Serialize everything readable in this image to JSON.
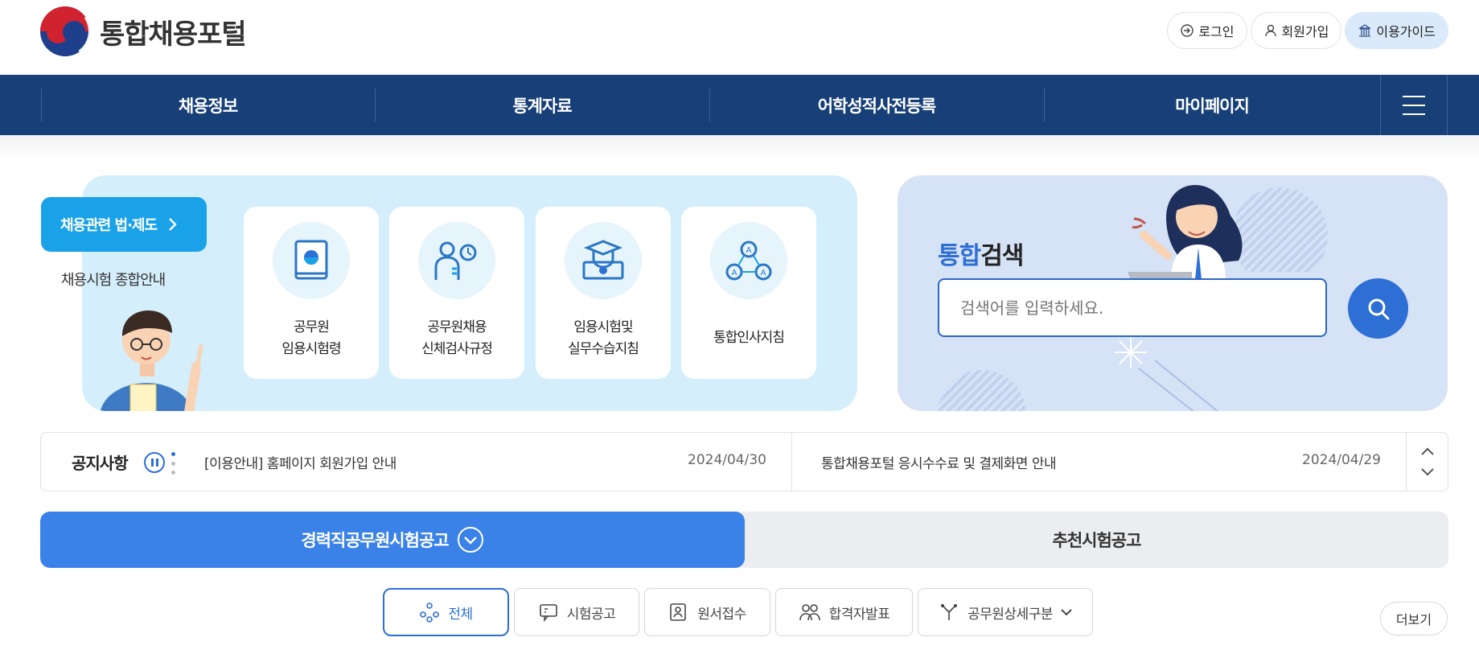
{
  "header": {
    "logo_text": "통합채용포털",
    "top_links": [
      "로그인",
      "회원가입",
      "이용가이드"
    ]
  },
  "nav": {
    "items": [
      "채용정보",
      "통계자료",
      "어학성적사전등록",
      "마이페이지"
    ]
  },
  "law": {
    "button_label": "채용관련 법·제도",
    "subtitle": "채용시험 종합안내",
    "cards": [
      {
        "line1": "공무원",
        "line2": "임용시험령",
        "icon": "book-icon"
      },
      {
        "line1": "공무원채용",
        "line2": "신체검사규정",
        "icon": "physical-exam-icon"
      },
      {
        "line1": "임용시험및",
        "line2": "실무수습지침",
        "icon": "graduate-icon"
      },
      {
        "line1": "통합인사지침",
        "line2": "",
        "icon": "network-icon"
      }
    ]
  },
  "search": {
    "title_highlight": "통합",
    "title_rest": "검색",
    "placeholder": "검색어를 입력하세요."
  },
  "notice": {
    "title": "공지사항",
    "items": [
      {
        "text": "[이용안내] 홈페이지 회원가입 안내",
        "date": "2024/04/30"
      },
      {
        "text": "통합채용포털 응시수수료 및 결제화면 안내",
        "date": "2024/04/29"
      }
    ]
  },
  "tabs": {
    "active": "경력직공무원시험공고",
    "other": "추천시험공고"
  },
  "filters": [
    "전체",
    "시험공고",
    "원서접수",
    "합격자발표",
    "공무원상세구분"
  ],
  "more_label": "더보기",
  "colors": {
    "nav_bg": "#173f78",
    "accent": "#2d6fd4",
    "active_tab": "#3b82e8",
    "law_button": "#1aa2e8"
  }
}
